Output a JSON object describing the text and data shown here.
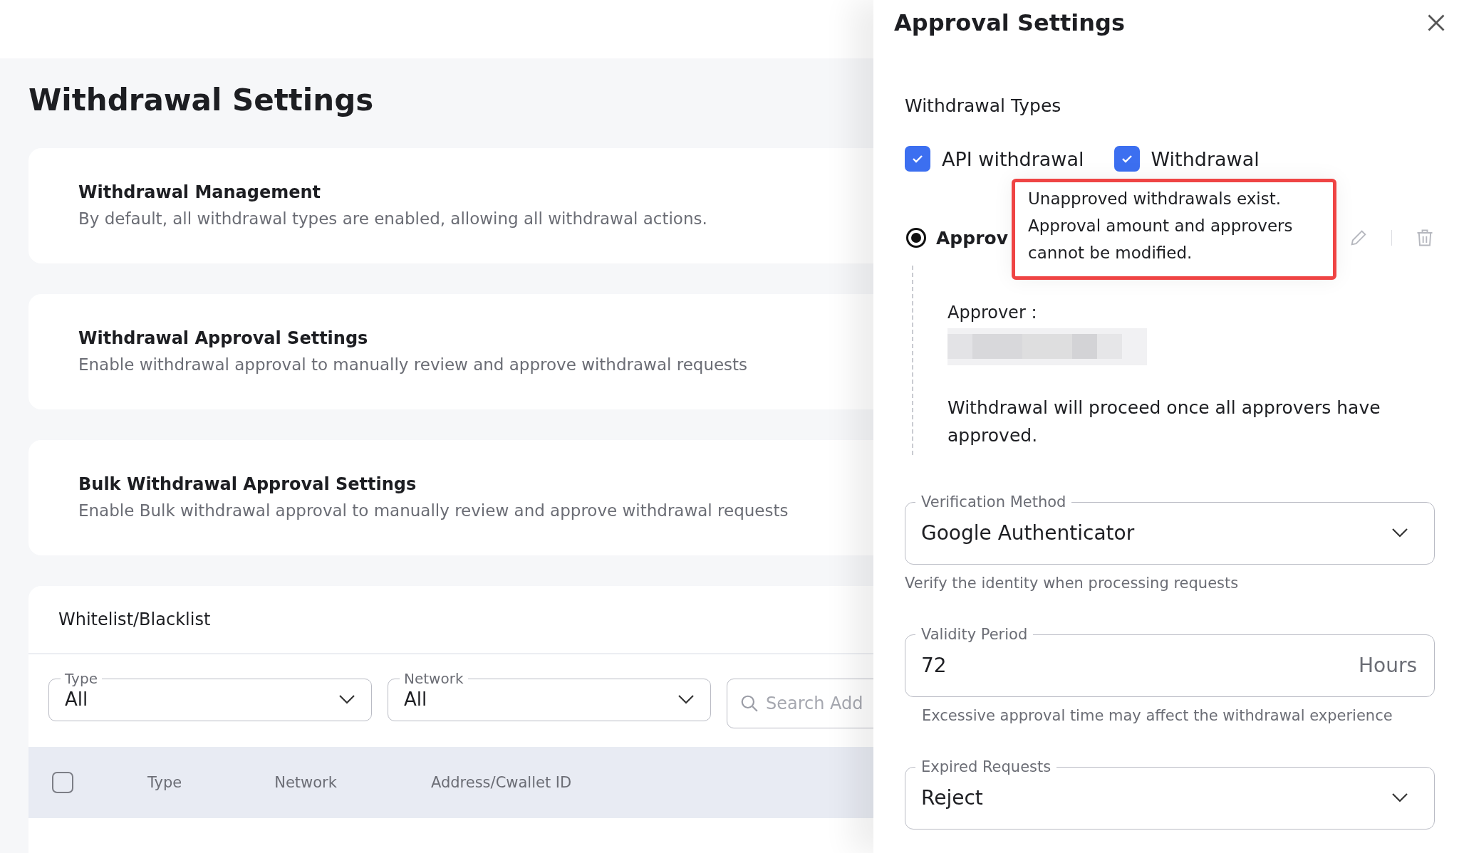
{
  "page": {
    "title": "Withdrawal Settings"
  },
  "settings_cards": [
    {
      "title": "Withdrawal Management",
      "description": "By default, all withdrawal types are enabled, allowing all withdrawal actions."
    },
    {
      "title": "Withdrawal Approval Settings",
      "description": "Enable withdrawal approval to manually review and approve withdrawal requests"
    },
    {
      "title": "Bulk Withdrawal Approval Settings",
      "description": "Enable Bulk withdrawal approval to manually review and approve withdrawal requests"
    }
  ],
  "whitelist": {
    "title": "Whitelist/Blacklist",
    "filters": [
      {
        "label": "Type",
        "value": "All"
      },
      {
        "label": "Network",
        "value": "All"
      }
    ],
    "search": {
      "placeholder": "Search Add"
    },
    "table": {
      "select_all_checked": false,
      "columns": [
        "Type",
        "Network",
        "Address/Cwallet ID"
      ]
    }
  },
  "drawer": {
    "title": "Approval Settings",
    "types_heading": "Withdrawal Types",
    "withdrawal_types": [
      {
        "label": "API withdrawal",
        "checked": true
      },
      {
        "label": "Withdrawal",
        "checked": true
      }
    ],
    "approval_rule": {
      "label": "Approv",
      "selected": true,
      "approver_label": "Approver :",
      "note": "Withdrawal will proceed once all approvers have approved."
    },
    "tooltip": "Unapproved withdrawals exist. Approval amount and approvers cannot be modified.",
    "fields": [
      {
        "kind": "select",
        "label": "Verification Method",
        "value": "Google Authenticator",
        "helper": "Verify the identity when processing requests"
      },
      {
        "kind": "number",
        "label": "Validity Period",
        "value": "72",
        "suffix": "Hours",
        "helper": "Excessive approval time may affect the withdrawal experience"
      },
      {
        "kind": "select",
        "label": "Expired Requests",
        "value": "Reject"
      }
    ]
  }
}
